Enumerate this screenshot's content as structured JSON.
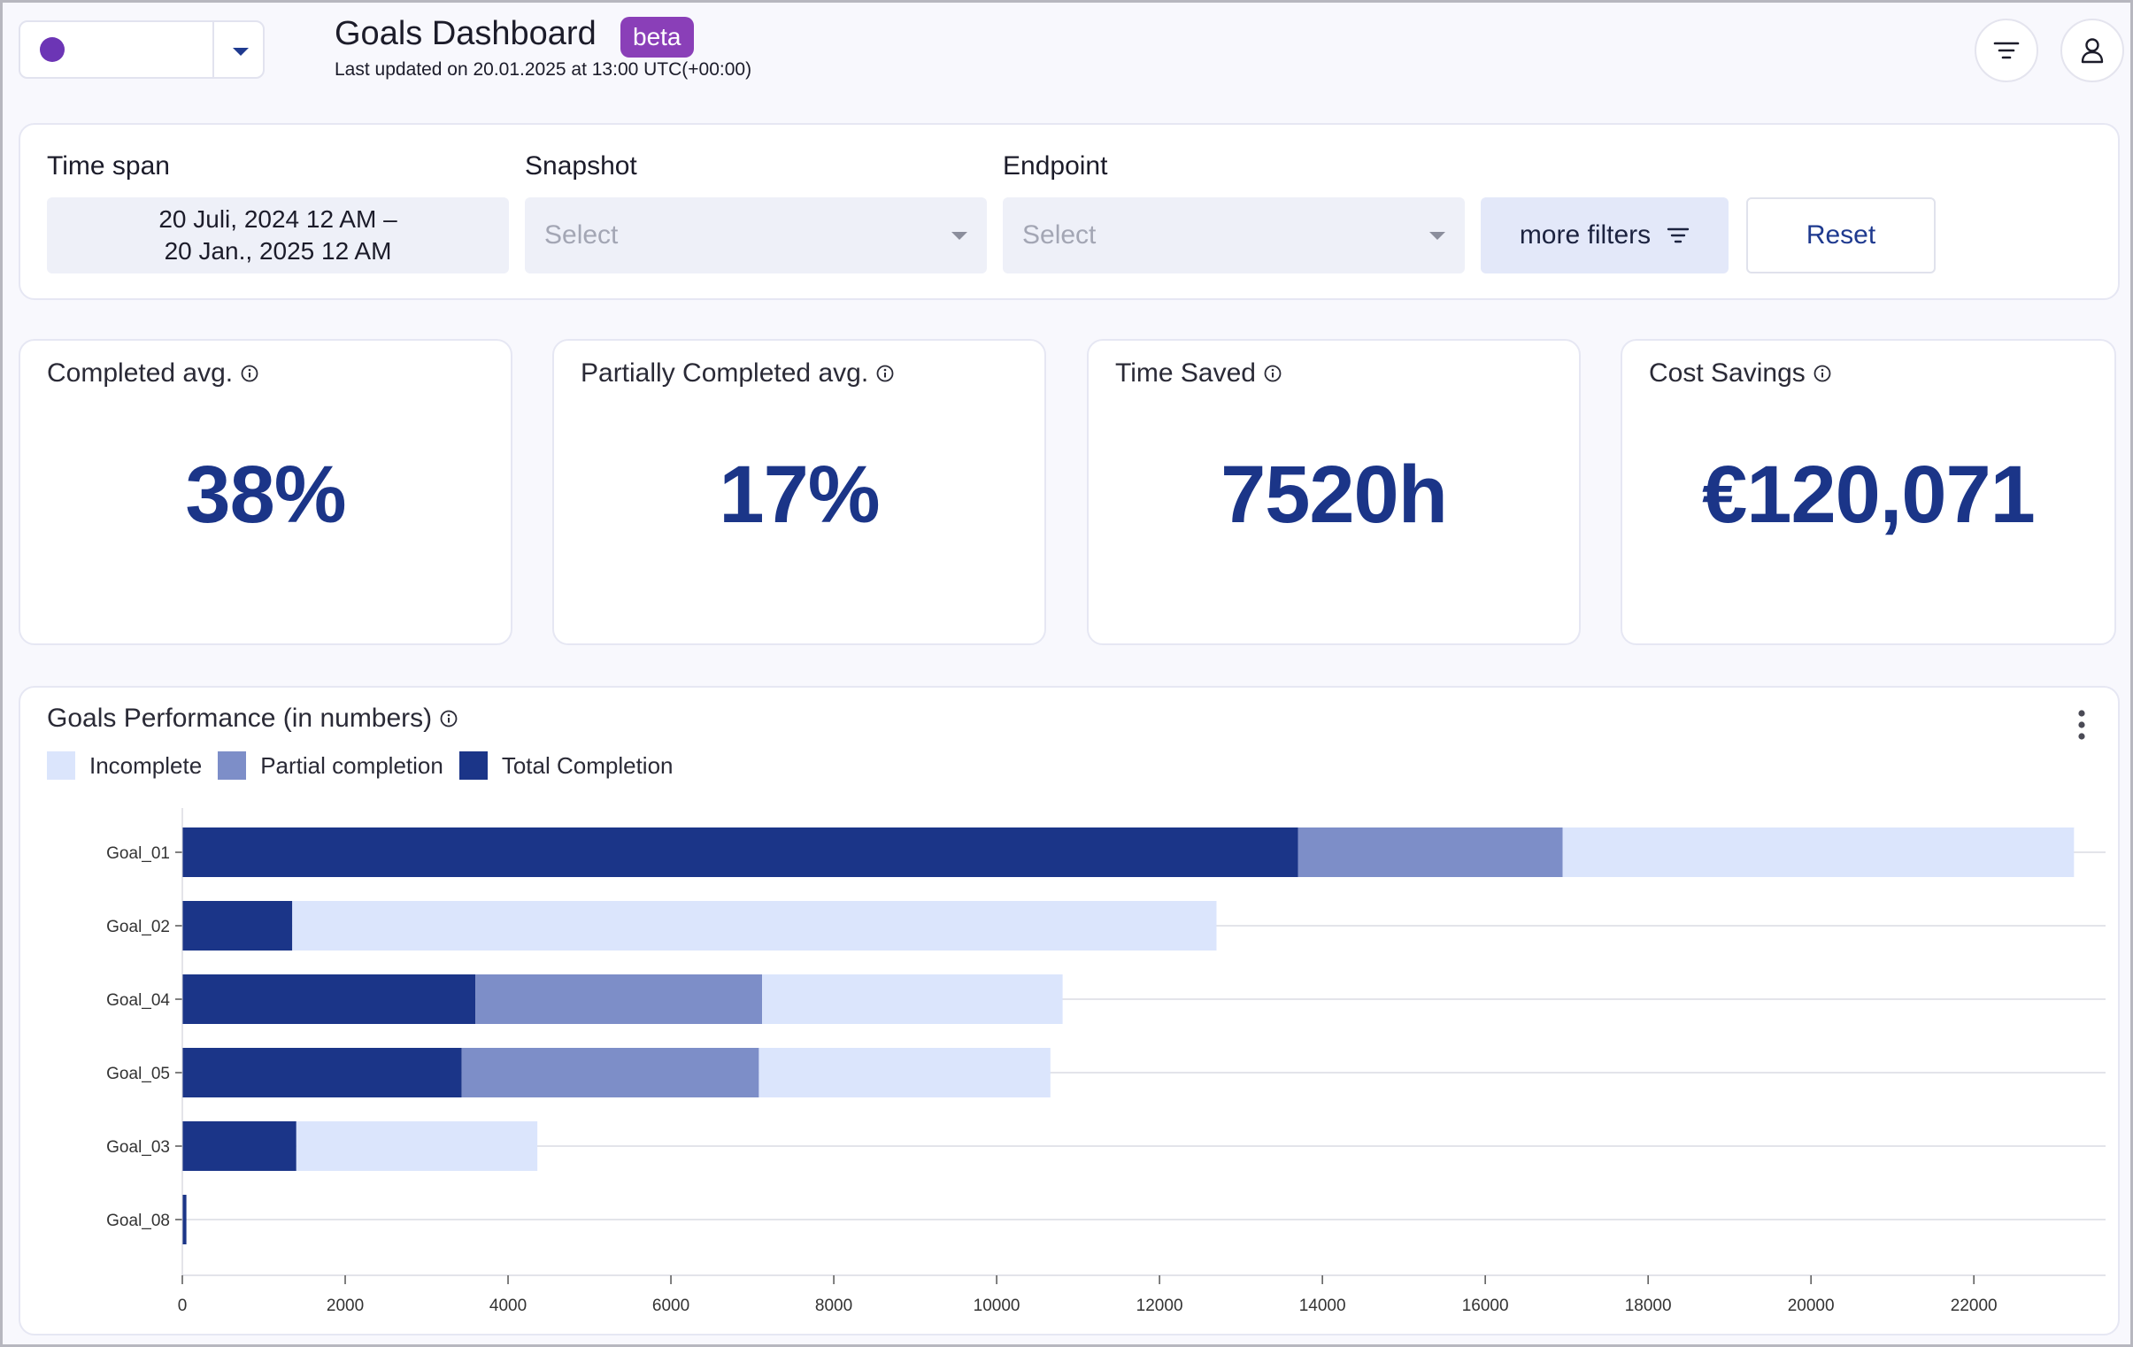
{
  "header": {
    "title": "Goals Dashboard",
    "badge": "beta",
    "last_updated": "Last updated on 20.01.2025 at 13:00 UTC(+00:00)"
  },
  "colors": {
    "brand_purple": "#6c35b5",
    "badge_purple": "#8a3fb8",
    "total_completion": "#1b3588",
    "partial_completion": "#7d8ec8",
    "incomplete": "#dbe5fc"
  },
  "filters": {
    "time_span": {
      "label": "Time span",
      "value_line1": "20 Juli, 2024 12 AM –",
      "value_line2": "20 Jan., 2025 12 AM"
    },
    "snapshot": {
      "label": "Snapshot",
      "placeholder": "Select"
    },
    "endpoint": {
      "label": "Endpoint",
      "placeholder": "Select"
    },
    "more_filters_label": "more filters",
    "reset_label": "Reset"
  },
  "kpis": [
    {
      "title": "Completed avg.",
      "value": "38%"
    },
    {
      "title": "Partially Completed avg.",
      "value": "17%"
    },
    {
      "title": "Time Saved",
      "value": "7520h"
    },
    {
      "title": "Cost Savings",
      "value": "€120,071"
    }
  ],
  "chart_title": "Goals Performance (in numbers)",
  "chart_data": {
    "type": "bar",
    "orientation": "horizontal",
    "stacked": true,
    "categories": [
      "Goal_01",
      "Goal_02",
      "Goal_04",
      "Goal_05",
      "Goal_03",
      "Goal_08"
    ],
    "series": [
      {
        "name": "Total Completion",
        "values": [
          13700,
          1350,
          3600,
          3430,
          1400,
          50
        ]
      },
      {
        "name": "Partial completion",
        "values": [
          3250,
          0,
          3520,
          3650,
          0,
          0
        ]
      },
      {
        "name": "Incomplete",
        "values": [
          6280,
          11350,
          3690,
          3580,
          2960,
          0
        ]
      }
    ],
    "legend_order": [
      "Incomplete",
      "Partial completion",
      "Total Completion"
    ],
    "xlim": [
      0,
      23400
    ],
    "xticks": [
      0,
      2000,
      4000,
      6000,
      8000,
      10000,
      12000,
      14000,
      16000,
      18000,
      20000,
      22000
    ],
    "grid": "horizontal lines per category",
    "legend_position": "top-left"
  }
}
